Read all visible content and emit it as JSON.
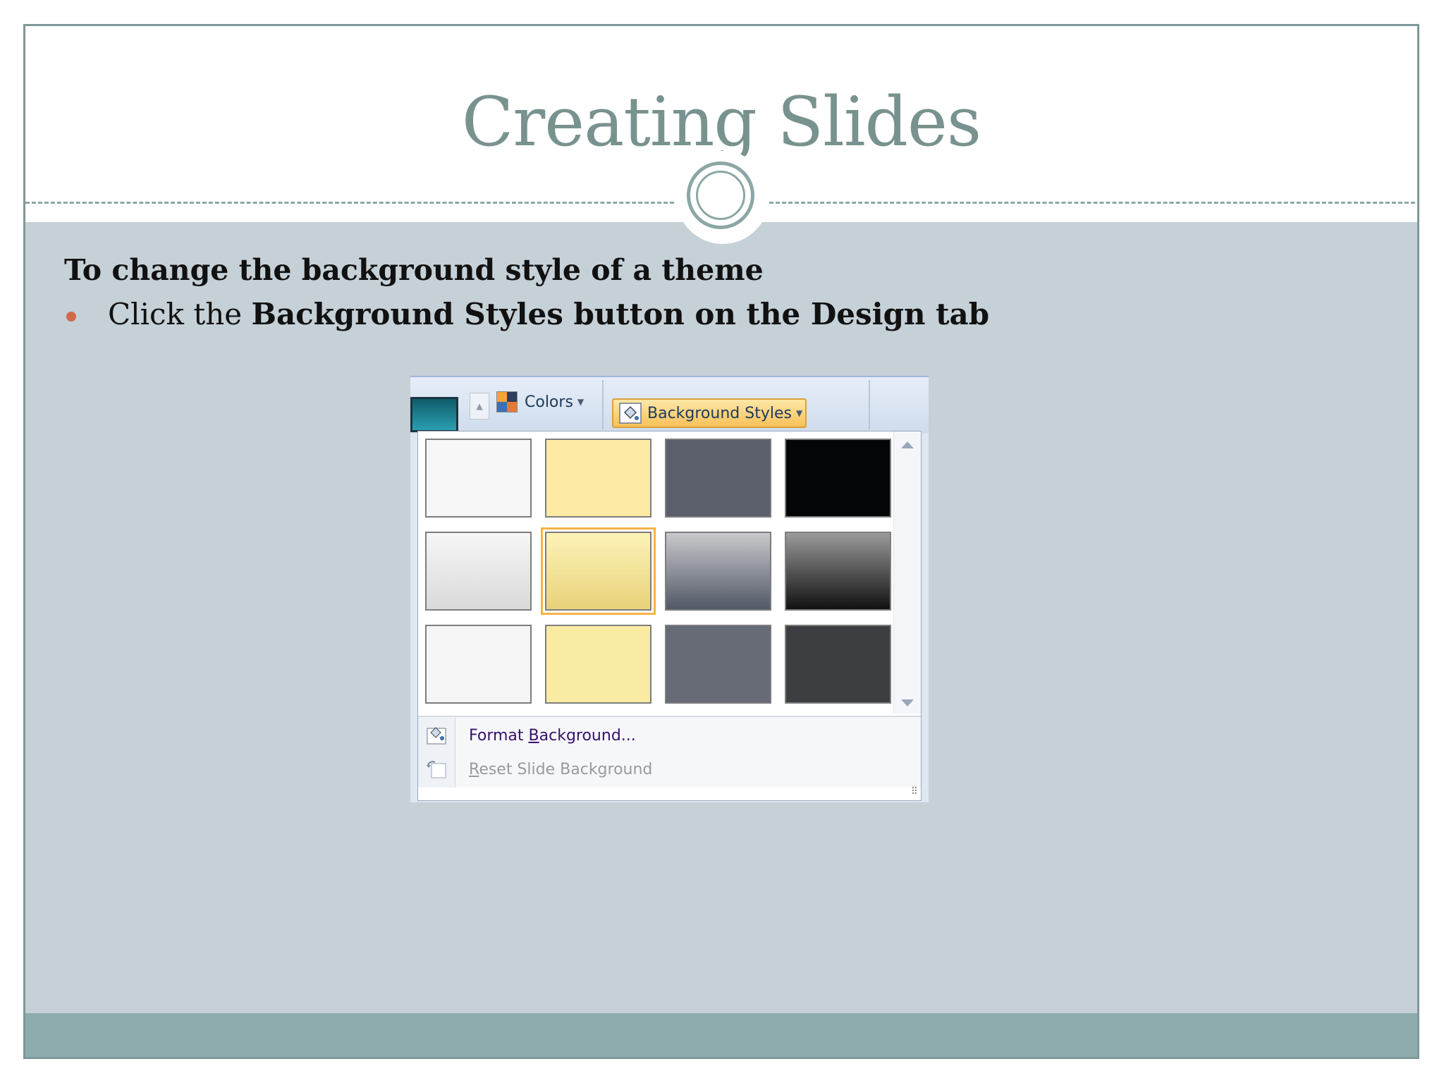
{
  "slide": {
    "title": "Creating Slides",
    "heading": "To change the background style of a theme",
    "bullet": {
      "prefix": "Click the ",
      "bold": "Background Styles button on the Design tab"
    }
  },
  "screenshot": {
    "ribbon": {
      "colors_label": "Colors",
      "background_styles_label": "Background Styles"
    },
    "gallery": {
      "tiles": [
        [
          "#f7f7f7",
          "#fdeba5",
          "#5a5f6b",
          "#040507"
        ],
        [
          "linear-gradient(#f6f6f6,#d9d9d9)",
          "linear-gradient(#fdf2b8,#e8d27a)",
          "linear-gradient(#c8c9cc,#525867)",
          "linear-gradient(#9a9a9a,#111111)"
        ],
        [
          "#f5f5f5",
          "#faeba2",
          "#666b76",
          "#3d3e42"
        ]
      ],
      "selected": [
        1,
        1
      ]
    },
    "menu": {
      "format_background": "Format Background...",
      "reset_background": "Reset Slide Background"
    }
  },
  "colors": {
    "title": "#78928f",
    "body_bg": "#c5d0d7",
    "footer": "#8eabad",
    "bullet": "#d2694a"
  }
}
